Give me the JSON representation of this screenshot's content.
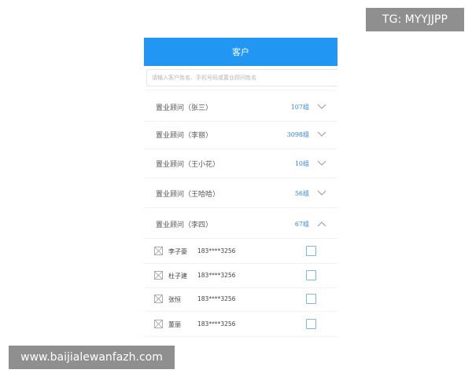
{
  "watermarks": {
    "top_right": "TG: MYYJJPP",
    "bottom_left": "www.baijialewanfazh.com"
  },
  "header": {
    "title": "客户"
  },
  "search": {
    "placeholder": "请输入客户姓名、手机号码或置业顾问姓名"
  },
  "groups": [
    {
      "label": "置业顾问（张三）",
      "count": "107组",
      "expanded": false
    },
    {
      "label": "置业顾问（李丽）",
      "count": "3098组",
      "expanded": false
    },
    {
      "label": "置业顾问（王小花）",
      "count": "10组",
      "expanded": false
    },
    {
      "label": "置业顾问（王哈哈）",
      "count": "56组",
      "expanded": false
    },
    {
      "label": "置业顾问（李四）",
      "count": "67组",
      "expanded": true
    }
  ],
  "members": [
    {
      "name": "李子豪",
      "phone": "183****3256"
    },
    {
      "name": "杜子建",
      "phone": "183****3256"
    },
    {
      "name": "张恒",
      "phone": "183****3256"
    },
    {
      "name": "董丽",
      "phone": "183****3256"
    }
  ],
  "colors": {
    "header_blue": "#2196f3",
    "count_blue": "#2f80d8",
    "checkbox_border": "#7fb6e8"
  },
  "icons": {
    "chevron_collapsed": "chevron-down-icon",
    "chevron_expanded": "chevron-up-icon",
    "avatar": "image-placeholder-icon"
  }
}
